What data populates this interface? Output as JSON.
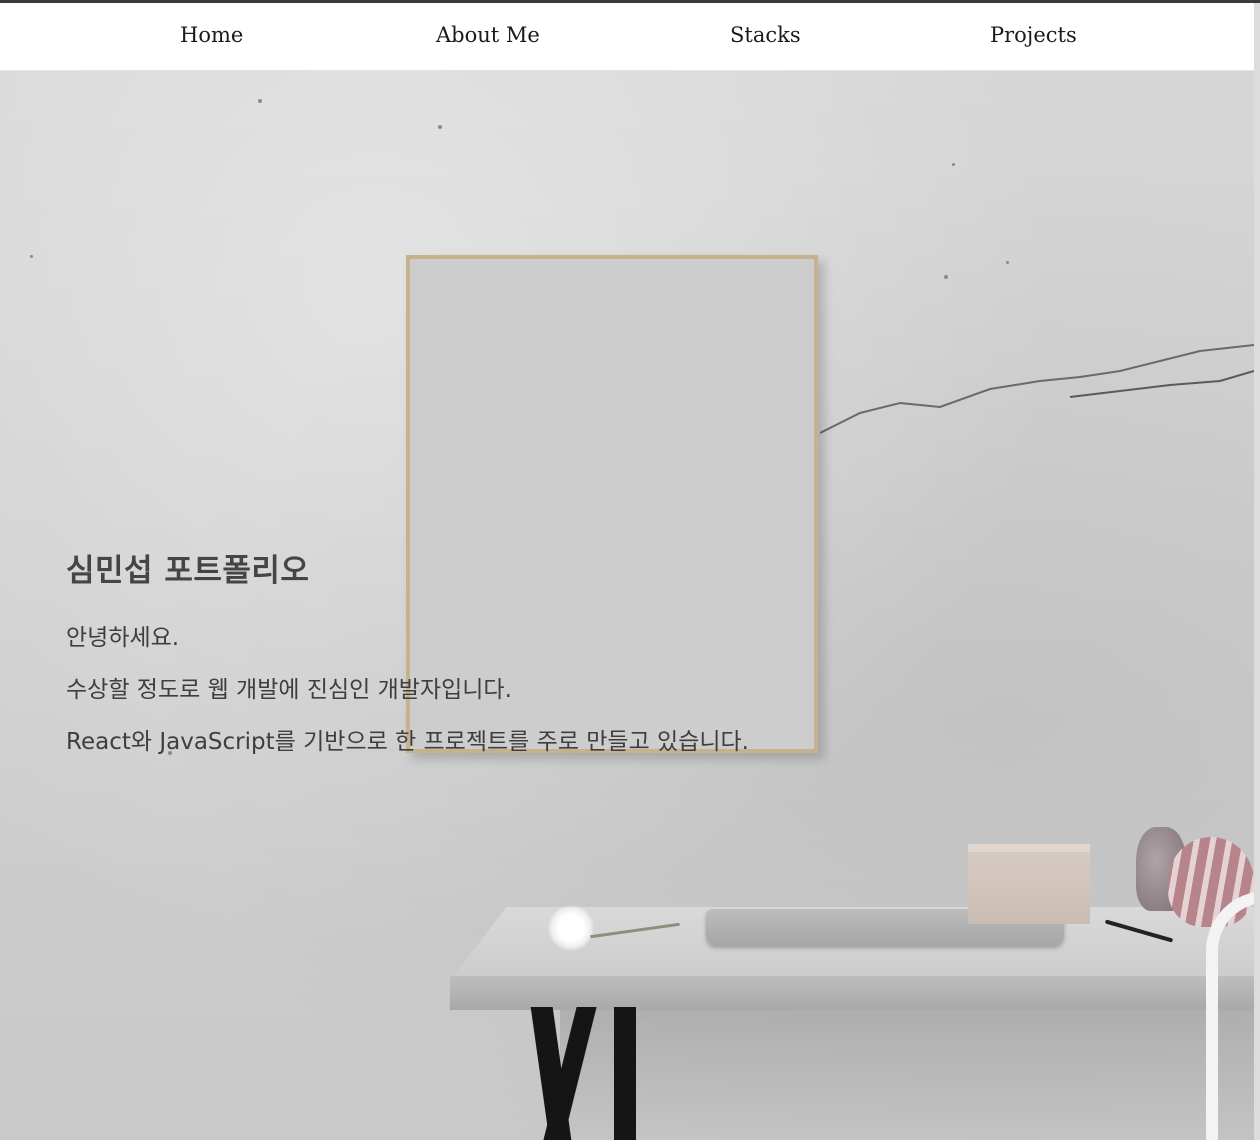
{
  "nav": {
    "items": [
      {
        "label": "Home"
      },
      {
        "label": "About Me"
      },
      {
        "label": "Stacks"
      },
      {
        "label": "Projects"
      }
    ]
  },
  "hero": {
    "title": "심민섭 포트폴리오",
    "lines": [
      "안녕하세요.",
      "수상할 정도로 웹 개발에 진심인 개발자입니다.",
      "React와 JavaScript를 기반으로 한 프로젝트를 주로 만들고 있습니다."
    ]
  },
  "colors": {
    "nav_background": "#ffffff",
    "nav_text": "#1a1a1a",
    "hero_text": "#3d3d3d",
    "frame_border": "#c7b290"
  }
}
